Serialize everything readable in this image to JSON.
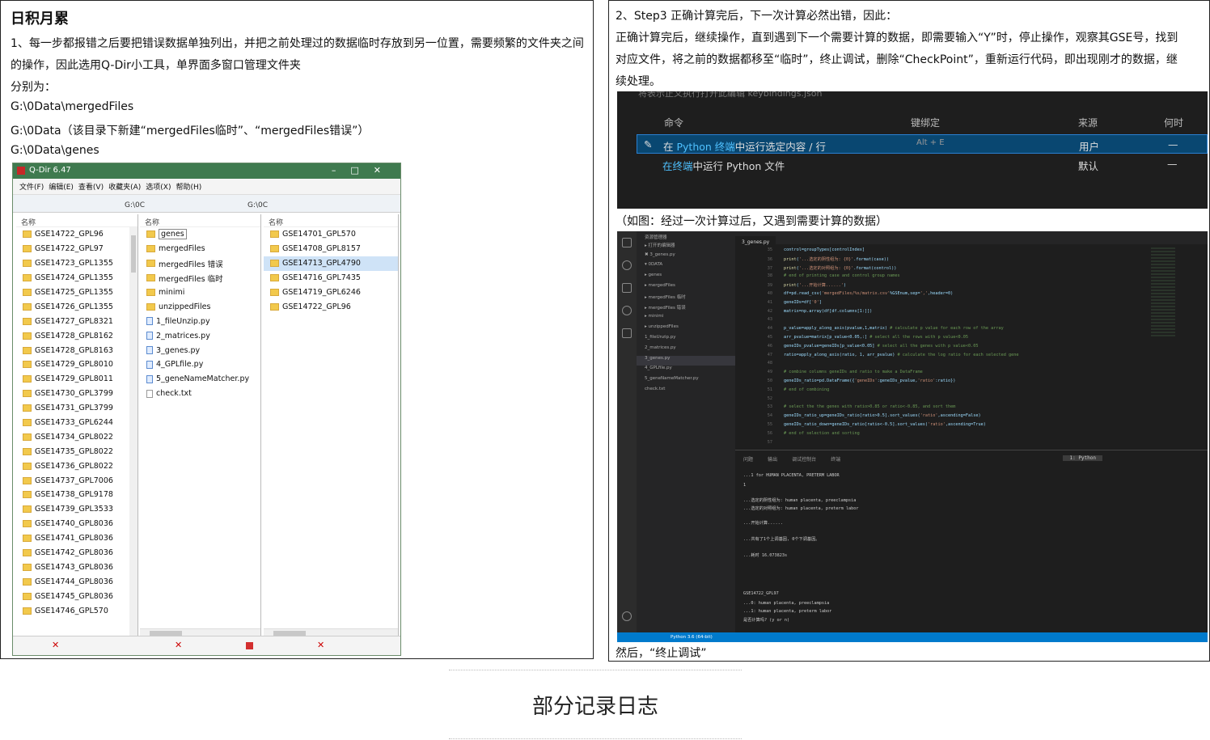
{
  "left": {
    "title": "日积月累",
    "line1": "1、每一步都报错之后要把错误数据单独列出，并把之前处理过的数据临时存放到另一位置，需要频繁的文件夹之间",
    "line2": "的操作，因此选用Q-Dir小工具，单界面多窗口管理文件夹",
    "line3": "分别为：",
    "path1": "G:\\0Data\\mergedFiles",
    "path2": "G:\\0Data（该目录下新建“mergedFiles临时”、“mergedFiles错误”）",
    "path3": "G:\\0Data\\genes"
  },
  "qdir": {
    "title": "Q-Dir 6.47",
    "menu": [
      "文件(F)",
      "编辑(E)",
      "查看(V)",
      "收藏夹(A)",
      "选项(X)",
      "帮助(H)"
    ],
    "pane_header": "名称",
    "addr1": "G:\\0C",
    "addr2": "G:\\0C",
    "pane1": [
      "GSE14722_GPL96",
      "GSE14722_GPL97",
      "GSE14723_GPL1355",
      "GSE14724_GPL1355",
      "GSE14725_GPL1355",
      "GSE14726_GPL1355",
      "GSE14727_GPL8321",
      "GSE14728_GPL8162",
      "GSE14728_GPL8163",
      "GSE14729_GPL8010",
      "GSE14729_GPL8011",
      "GSE14730_GPL3799",
      "GSE14731_GPL3799",
      "GSE14733_GPL6244",
      "GSE14734_GPL8022",
      "GSE14735_GPL8022",
      "GSE14736_GPL8022",
      "GSE14737_GPL7006",
      "GSE14738_GPL9178",
      "GSE14739_GPL3533",
      "GSE14740_GPL8036",
      "GSE14741_GPL8036",
      "GSE14742_GPL8036",
      "GSE14743_GPL8036",
      "GSE14744_GPL8036",
      "GSE14745_GPL8036",
      "GSE14746_GPL570"
    ],
    "pane2_folders": [
      "genes",
      "mergedFiles",
      "mergedFiles 错误",
      "mergedFiles 临时",
      "minimi",
      "unzippedFiles"
    ],
    "pane2_files": [
      "1_fileUnzip.py",
      "2_matrices.py",
      "3_genes.py",
      "4_GPLfile.py",
      "5_geneNameMatcher.py"
    ],
    "pane2_txt": "check.txt",
    "pane3": [
      "GSE14701_GPL570",
      "GSE14708_GPL8157",
      "GSE14713_GPL4790",
      "GSE14716_GPL7435",
      "GSE14719_GPL6246",
      "GSE14722_GPL96"
    ]
  },
  "right": {
    "line1": "2、Step3 正确计算完后，下一次计算必然出错，因此：",
    "line2": "正确计算完后，继续操作，直到遇到下一个需要计算的数据，即需要输入“Y”时，停止操作，观察其GSE号，找到",
    "line3": "对应文件，将之前的数据都移至“临时”，终止调试，删除“CheckPoint”，重新运行代码，即出现刚才的数据，继",
    "line4": "续处理。",
    "caption1": "（如图：经过一次计算过后，又遇到需要计算的数据）",
    "after": "然后，“终止调试”"
  },
  "cmd": {
    "faint": "将表示正义执行打开此编辑 keybindings.json",
    "headers": [
      "命令",
      "键绑定",
      "来源",
      "何时"
    ],
    "row1": {
      "pre": "在 ",
      "hl": "Python 终端",
      "post": "中运行选定内容 / 行",
      "key": "Alt + E",
      "src": "用户",
      "when": "—"
    },
    "row2": {
      "hl": "在终端",
      "post": "中运行 Python 文件",
      "src": "默认",
      "when": "—"
    }
  },
  "vscode": {
    "explorer_title": "资源管理器",
    "explorer": [
      "▸ 打开的编辑器",
      "✖ 3_genes.py",
      "▾ 0DATA",
      "▸ genes",
      "▸ mergedFiles",
      "▸ mergedFiles 临时",
      "▸ mergedFiles 错误",
      "▸ minimi",
      "▸ unzippedFiles",
      "1_fileUnzip.py",
      "2_matrices.py",
      "3_genes.py",
      "4_GPLfile.py",
      "5_geneNameMatcher.py",
      "check.txt"
    ],
    "tab": "3_genes.py",
    "terminal_tabs": [
      "问题",
      "输出",
      "调试控制台",
      "终端"
    ],
    "terminal_select": "1: Python",
    "status": "Python 3.6 (64-bit)",
    "terminal_lines": [
      "...1 for HUMAN PLACENTA, PRETERM LABOR",
      "1",
      "...选定的阴性组为:  human placenta, preeclampsia",
      "...选定的对照组为:  human placenta, preterm labor",
      "...开始计算......",
      "...共有了1个上调基因, 0个下调基因。",
      "...耗时 16.073823s",
      "GSE14722_GPL97",
      "...0: human placenta, preeclampsia",
      "...1: human placenta, preterm labor",
      "是否计算吗? (y or n)"
    ]
  },
  "caption": "部分记录日志"
}
